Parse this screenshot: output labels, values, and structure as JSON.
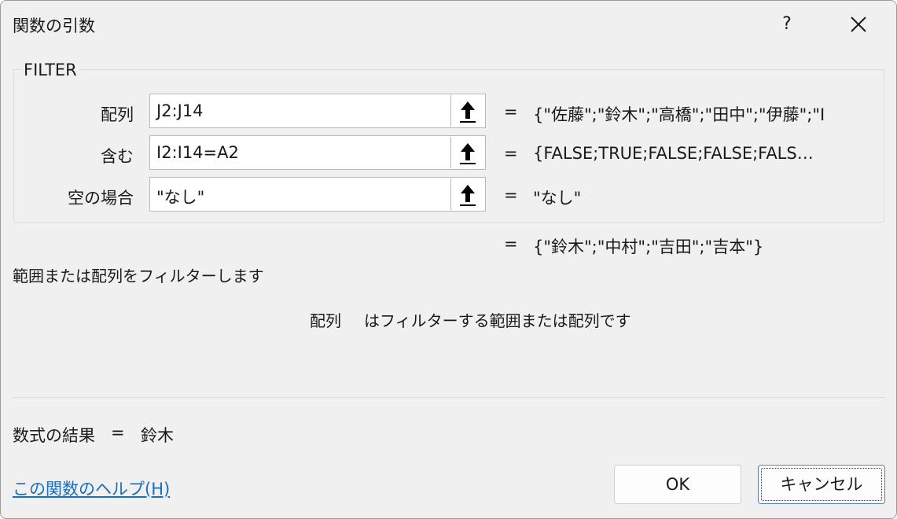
{
  "window": {
    "title": "関数の引数",
    "help_label": "?"
  },
  "function": {
    "name": "FILTER",
    "args": [
      {
        "label": "配列",
        "value": "J2:J14",
        "result": "{\"佐藤\";\"鈴木\";\"高橋\";\"田中\";\"伊藤\";\"I"
      },
      {
        "label": "含む",
        "value": "I2:I14=A2",
        "result": "{FALSE;TRUE;FALSE;FALSE;FALS…"
      },
      {
        "label": "空の場合",
        "value": "\"なし\"",
        "result": "\"なし\""
      }
    ],
    "equals": "=",
    "overall_result": "{\"鈴木\";\"中村\";\"吉田\";\"吉本\"}"
  },
  "description": "範囲または配列をフィルターします",
  "arg_help": {
    "name": "配列",
    "text": "はフィルターする範囲または配列です"
  },
  "formula_result": {
    "label": "数式の結果",
    "eq": "=",
    "value": "鈴木"
  },
  "footer": {
    "help_link": "この関数のヘルプ(H)",
    "ok_label": "OK",
    "cancel_label": "キャンセル"
  },
  "icons": {
    "ref_button": "collapse-dialog-arrow-up-icon",
    "close": "close-icon"
  }
}
